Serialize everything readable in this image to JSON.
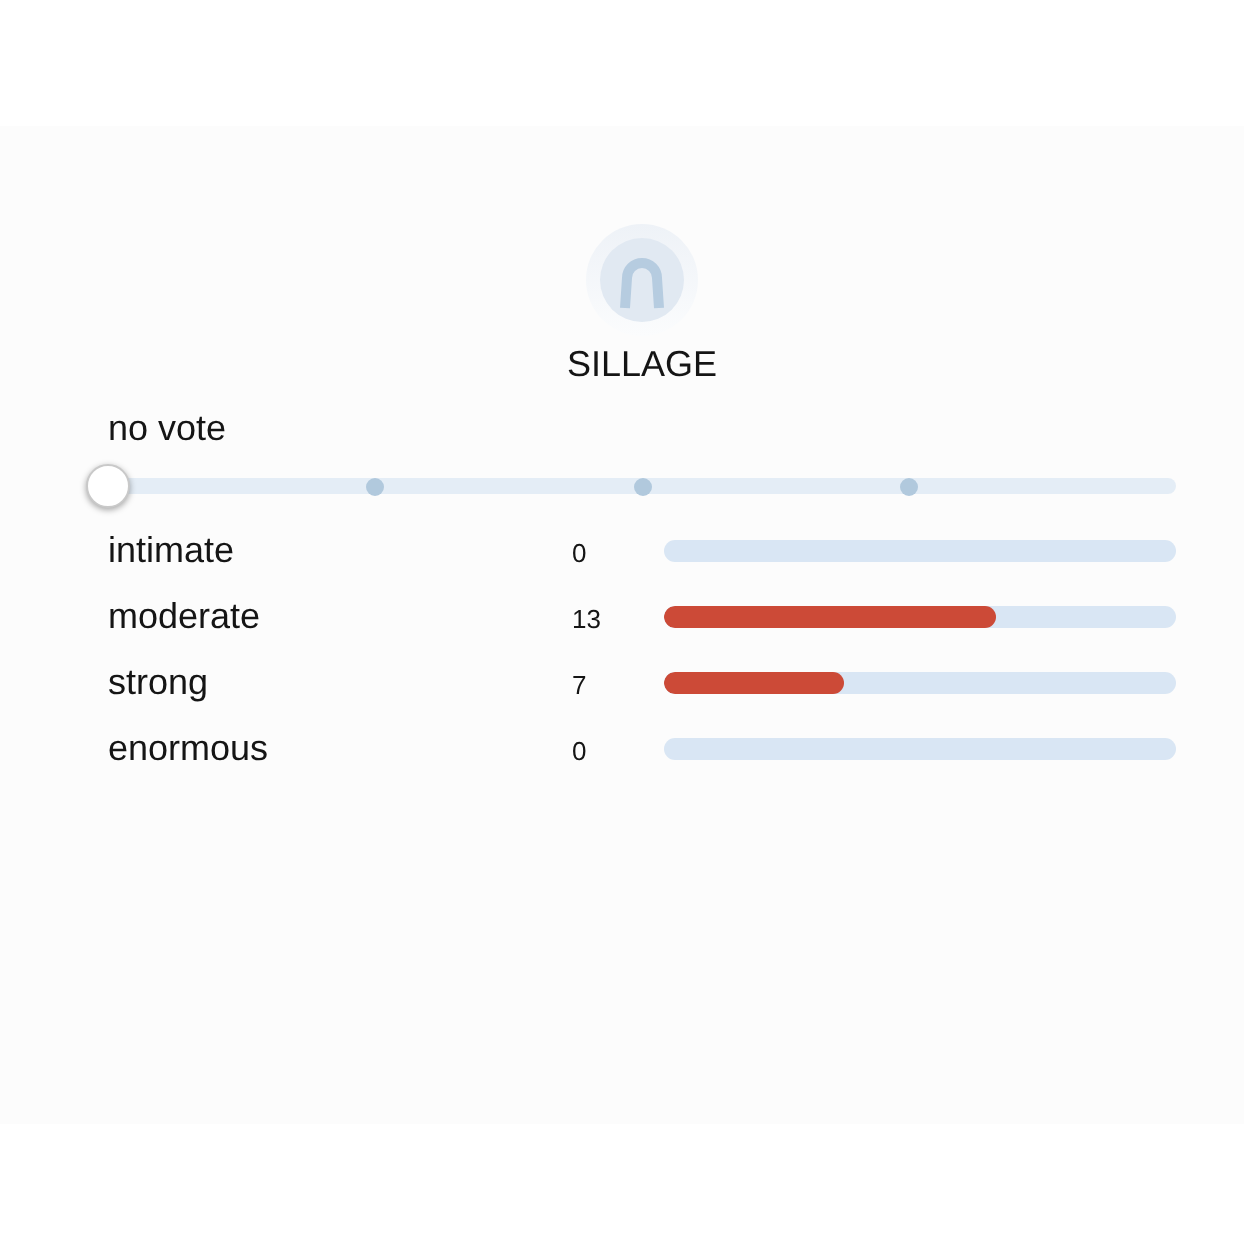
{
  "header": {
    "title": "SILLAGE"
  },
  "vote": {
    "status": "no vote",
    "slider": {
      "level": 0
    }
  },
  "rows": [
    {
      "label": "intimate",
      "count": "0",
      "level": 0
    },
    {
      "label": "moderate",
      "count": "13",
      "level": 0.65
    },
    {
      "label": "strong",
      "count": "7",
      "level": 0.35
    },
    {
      "label": "enormous",
      "count": "0",
      "level": 0
    }
  ]
}
